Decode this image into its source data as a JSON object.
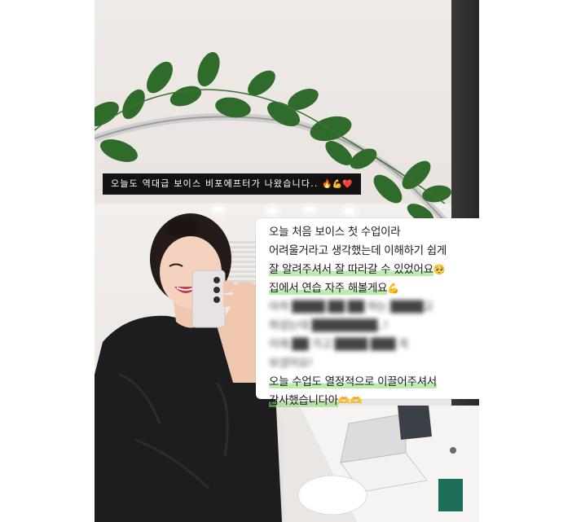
{
  "caption": {
    "text": "오늘도 역대급 보이스 비포에프터가 나왔습니다..",
    "emojis": "🔥💪❤️"
  },
  "message": {
    "lines": [
      {
        "text": "오늘 처음 보이스 첫 수업이라",
        "highlight": false,
        "blurred": false
      },
      {
        "text": "어려울거라고 생각했는데 이해하기 쉽게",
        "highlight": false,
        "blurred": false
      },
      {
        "text": "잘 알려주셔서 잘 따라갈 수 있었어요",
        "emoji": "🥺",
        "highlight": true,
        "blurred": false
      },
      {
        "text": "집에서 연습 자주 해볼게요",
        "emoji": "💪",
        "highlight": true,
        "blurred": false
      },
      {
        "text": "아까 ████ ██ ██ 하는 ████고",
        "highlight": false,
        "blurred": true
      },
      {
        "text": "하셨는데 ████████..!",
        "highlight": false,
        "blurred": true
      },
      {
        "text": "이제 ██ 가고 ████ ███ 꼭",
        "highlight": false,
        "blurred": true
      },
      {
        "text": "보셨어요!",
        "highlight": false,
        "blurred": true
      },
      {
        "text": "오늘 수업도 열정적으로 이끌어주셔서",
        "highlight": true,
        "blurred": false
      },
      {
        "text": "감사했습니다아",
        "emoji": "🫶🫶",
        "highlight": true,
        "blurred": false
      }
    ]
  },
  "colors": {
    "caption_bg": "#121212",
    "highlight": "#82dc6e",
    "leaf": "#2f6b2a"
  }
}
